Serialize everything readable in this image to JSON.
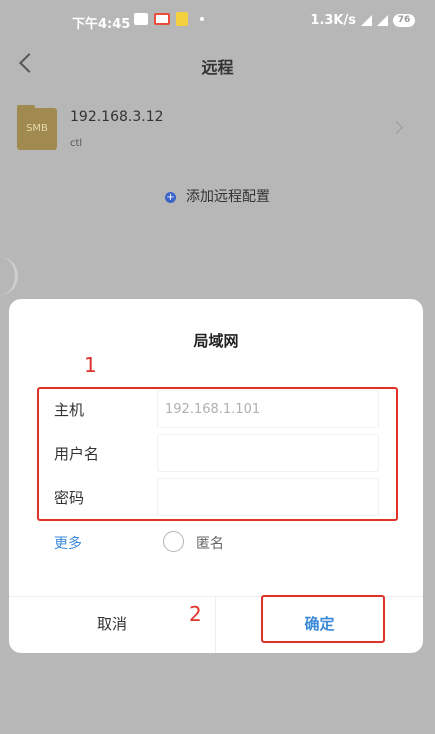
{
  "status_bar": {
    "time": "下午4:45",
    "net_speed": "1.3K/s",
    "battery": "76"
  },
  "nav": {
    "title": "远程"
  },
  "remote_list": [
    {
      "name": "192.168.3.12",
      "subtitle": "ctl",
      "icon_label": "SMB"
    }
  ],
  "add_config": {
    "label": "添加远程配置"
  },
  "dialog": {
    "title": "局域网",
    "fields": {
      "host": {
        "label": "主机",
        "value": "",
        "placeholder": "192.168.1.101"
      },
      "username": {
        "label": "用户名",
        "value": "",
        "placeholder": ""
      },
      "password": {
        "label": "密码",
        "value": "",
        "placeholder": ""
      }
    },
    "more_label": "更多",
    "anonymous_label": "匿名",
    "anonymous_checked": false,
    "cancel_label": "取消",
    "confirm_label": "确定"
  },
  "annotations": {
    "box1_number": "1",
    "box2_number": "2",
    "color": "#e0322a"
  },
  "colors": {
    "accent": "#3a8ad8",
    "overlay": "#b7b7b7",
    "add_icon": "#3b63c8"
  }
}
